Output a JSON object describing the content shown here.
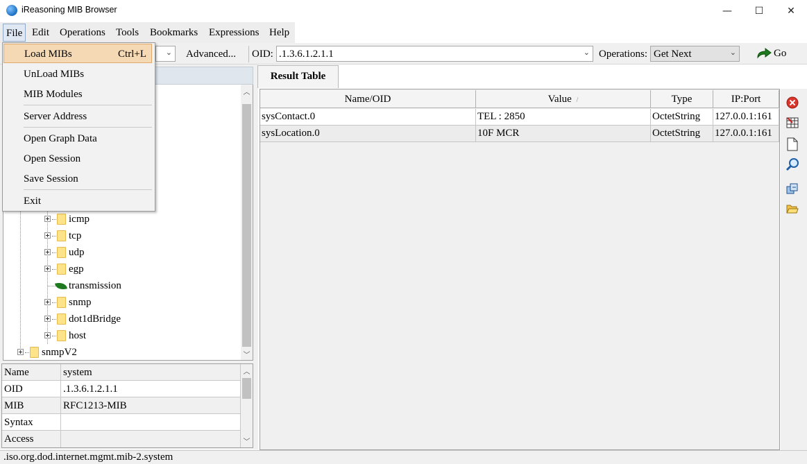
{
  "window": {
    "title": "iReasoning MIB Browser",
    "controls": {
      "minimize": "—",
      "maximize": "☐",
      "close": "✕"
    }
  },
  "menubar": {
    "items": [
      "File",
      "Edit",
      "Operations",
      "Tools",
      "Bookmarks",
      "Expressions",
      "Help"
    ]
  },
  "toolbar": {
    "advanced_label": "Advanced...",
    "oid_label": "OID:",
    "oid_value": ".1.3.6.1.2.1.1",
    "operations_label": "Operations:",
    "operations_value": "Get Next",
    "go_label": "Go"
  },
  "file_menu": {
    "items": [
      {
        "label": "Load MIBs",
        "shortcut": "Ctrl+L"
      },
      {
        "label": "UnLoad MIBs"
      },
      {
        "label": "MIB Modules"
      },
      {
        "label": "Server Address"
      },
      {
        "label": "Open Graph Data"
      },
      {
        "label": "Open Session"
      },
      {
        "label": "Save Session"
      },
      {
        "label": "Exit"
      }
    ]
  },
  "tree": {
    "nodes": [
      "icmp",
      "tcp",
      "udp",
      "egp",
      "transmission",
      "snmp",
      "dot1dBridge",
      "host",
      "snmpV2"
    ]
  },
  "properties": {
    "rows": [
      {
        "key": "Name",
        "value": "system"
      },
      {
        "key": "OID",
        "value": ".1.3.6.1.2.1.1"
      },
      {
        "key": "MIB",
        "value": "RFC1213-MIB"
      },
      {
        "key": "Syntax",
        "value": ""
      },
      {
        "key": "Access",
        "value": ""
      }
    ]
  },
  "result_table": {
    "tab_label": "Result Table",
    "columns": [
      "Name/OID",
      "Value",
      "Type",
      "IP:Port"
    ],
    "sort_indicator": "/",
    "rows": [
      [
        "sysContact.0",
        "TEL : 2850",
        "OctetString",
        "127.0.0.1:161"
      ],
      [
        "sysLocation.0",
        "10F MCR",
        "OctetString",
        "127.0.0.1:161"
      ]
    ]
  },
  "side_toolbar": {
    "icons": [
      "delete-icon",
      "table-grid-icon",
      "new-document-icon",
      "search-icon",
      "export-icon",
      "open-folder-icon"
    ]
  },
  "status": {
    "path": ".iso.org.dod.internet.mgmt.mib-2.system"
  },
  "colors": {
    "menu_highlight": "#f5d9b4",
    "go_arrow": "#1e7a1e",
    "delete": "#d9352b"
  }
}
